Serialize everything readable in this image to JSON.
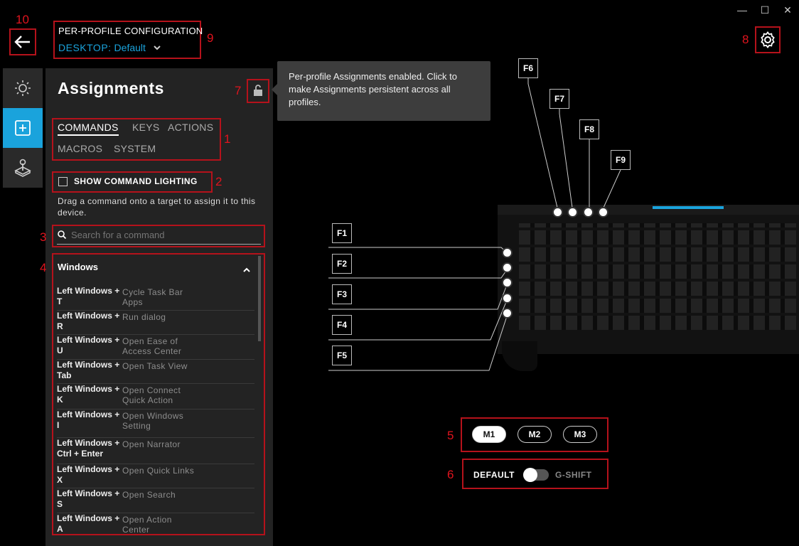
{
  "window_controls": {
    "minimize": "—",
    "maximize": "☐",
    "close": "✕"
  },
  "header": {
    "config_title": "PER-PROFILE CONFIGURATION",
    "profile_prefix": "DESKTOP:",
    "profile_name": "Default"
  },
  "annotations": [
    "1",
    "2",
    "3",
    "4",
    "5",
    "6",
    "7",
    "8",
    "9",
    "10"
  ],
  "tooltip": {
    "text": "Per-profile Assignments enabled. Click to make Assignments persistent across all profiles."
  },
  "panel": {
    "title": "Assignments",
    "tabs": [
      "COMMANDS",
      "KEYS",
      "ACTIONS",
      "MACROS",
      "SYSTEM"
    ],
    "active_tab": "COMMANDS",
    "show_lighting_label": "SHOW COMMAND LIGHTING",
    "hint": "Drag a command onto a target to assign it to this device.",
    "search_placeholder": "Search for a command",
    "group_title": "Windows",
    "commands": [
      {
        "key": "Left Windows + T",
        "action": "Cycle Task Bar Apps"
      },
      {
        "key": "Left Windows + R",
        "action": "Run dialog"
      },
      {
        "key": "Left Windows + U",
        "action": "Open Ease of Access Center"
      },
      {
        "key": "Left Windows + Tab",
        "action": "Open Task View"
      },
      {
        "key": "Left Windows + K",
        "action": "Open Connect Quick Action"
      },
      {
        "key": "Left Windows + I",
        "action": "Open Windows Setting"
      },
      {
        "key": "Left Windows + Ctrl + Enter",
        "action": "Open Narrator"
      },
      {
        "key": "Left Windows + X",
        "action": "Open Quick Links"
      },
      {
        "key": "Left Windows + S",
        "action": "Open Search"
      },
      {
        "key": "Left Windows + A",
        "action": "Open Action Center"
      }
    ]
  },
  "gkeys": {
    "top": [
      "F6",
      "F7",
      "F8",
      "F9"
    ],
    "left": [
      "F1",
      "F2",
      "F3",
      "F4",
      "F5"
    ]
  },
  "modes": {
    "items": [
      "M1",
      "M2",
      "M3"
    ],
    "active": "M1"
  },
  "gshift": {
    "left_label": "DEFAULT",
    "right_label": "G-SHIFT"
  },
  "colors": {
    "accent": "#1aa3dc",
    "annotation": "#e0141e",
    "panel_bg": "#232323"
  }
}
